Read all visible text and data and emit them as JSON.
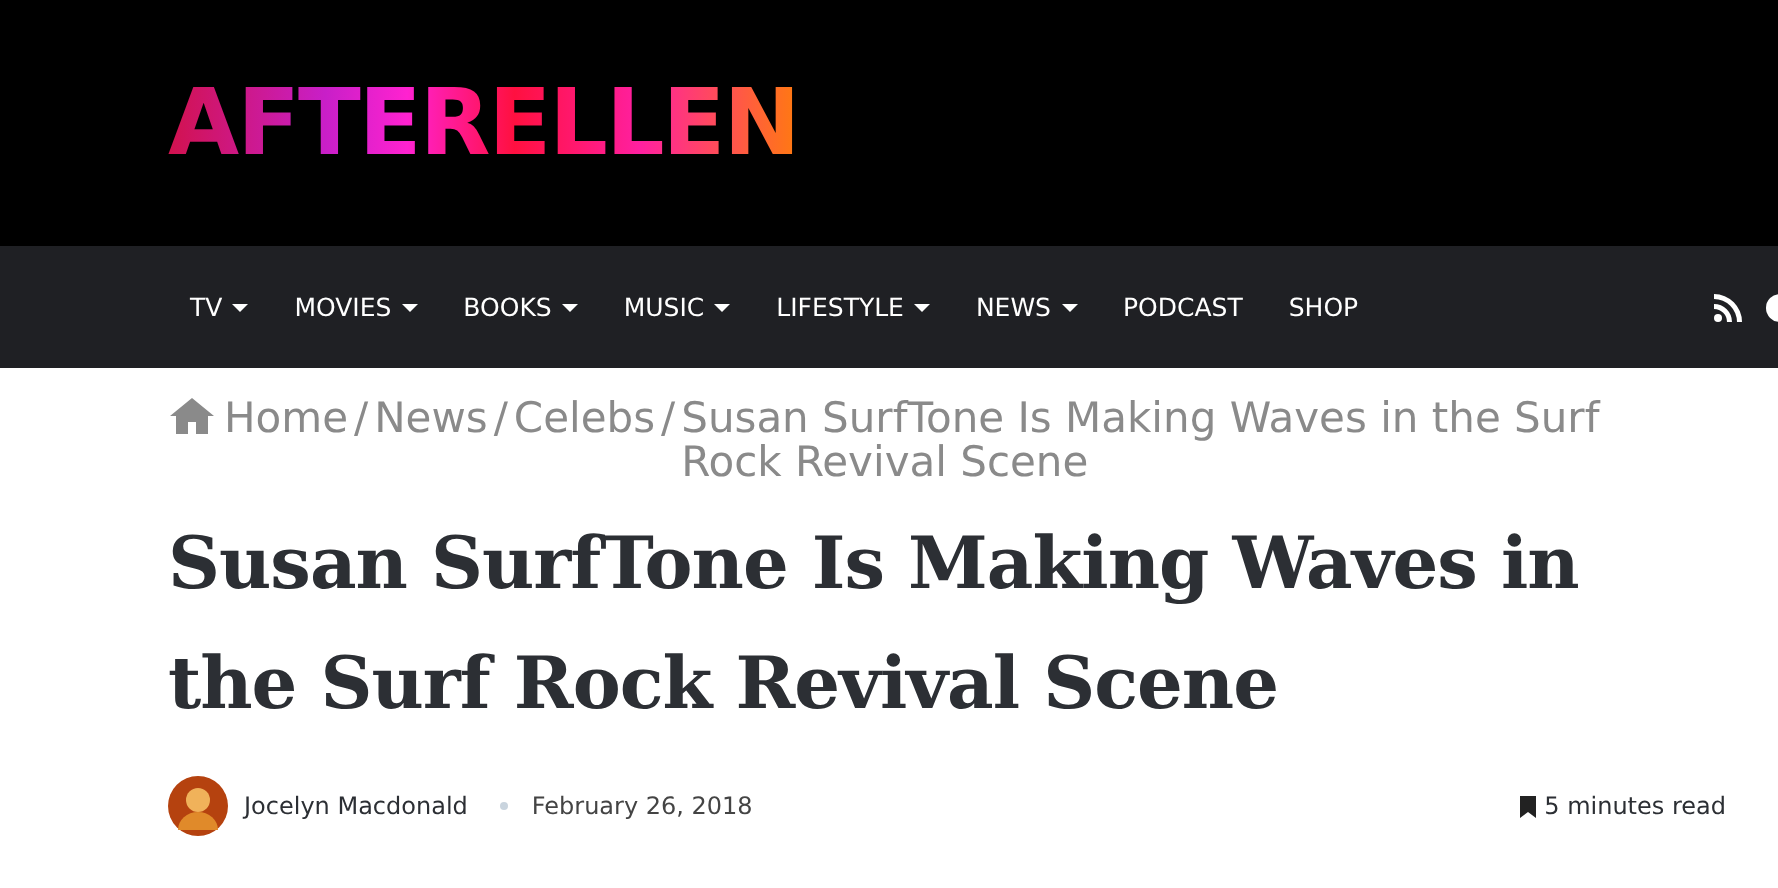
{
  "logo": "AFTERELLEN",
  "nav": [
    {
      "label": "TV",
      "dropdown": true
    },
    {
      "label": "MOVIES",
      "dropdown": true
    },
    {
      "label": "BOOKS",
      "dropdown": true
    },
    {
      "label": "MUSIC",
      "dropdown": true
    },
    {
      "label": "LIFESTYLE",
      "dropdown": true
    },
    {
      "label": "NEWS",
      "dropdown": true
    },
    {
      "label": "PODCAST",
      "dropdown": false
    },
    {
      "label": "SHOP",
      "dropdown": false
    }
  ],
  "breadcrumb": [
    {
      "label": "Home"
    },
    {
      "separator": "/",
      "label": "News"
    },
    {
      "separator": "/",
      "label": "Celebs"
    },
    {
      "separator": "/",
      "label": "Susan SurfTone Is Making Waves in the Surf Rock Revival Scene"
    }
  ],
  "title": "Susan SurfTone Is Making Waves in the Surf Rock Revival Scene",
  "meta": {
    "author": "Jocelyn Macdonald",
    "date": "February 26, 2018",
    "read_time": "5 minutes read"
  }
}
